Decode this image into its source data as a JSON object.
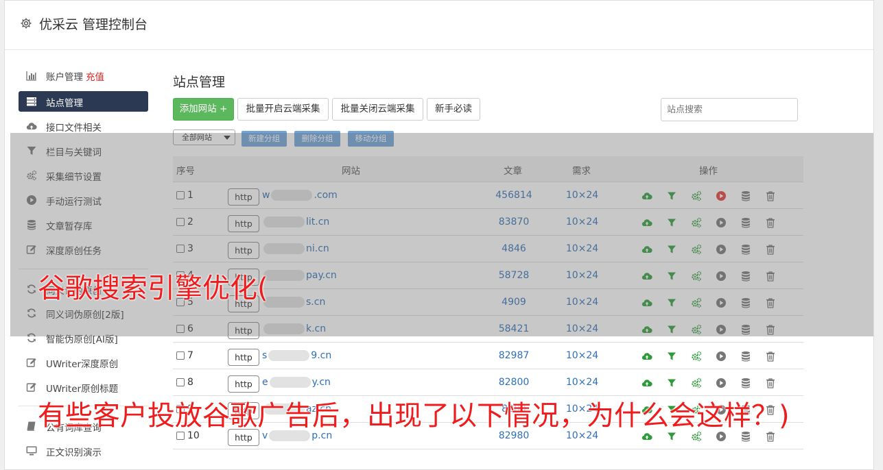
{
  "header": {
    "title": "优采云 管理控制台"
  },
  "sidebar": {
    "items": [
      {
        "label": "账户管理",
        "extra": "充值",
        "icon": "bar-chart-icon"
      },
      {
        "label": "站点管理",
        "icon": "server-icon"
      },
      {
        "label": "接口文件相关",
        "icon": "cloud-upload-icon"
      },
      {
        "label": "栏目与关键词",
        "icon": "filter-icon"
      },
      {
        "label": "采集细节设置",
        "icon": "gears-icon"
      },
      {
        "label": "手动运行测试",
        "icon": "play-circle-icon"
      },
      {
        "label": "文章暂存库",
        "icon": "database-icon"
      },
      {
        "label": "深度原创任务",
        "icon": "edit-icon"
      },
      {
        "label": "同义词伪原创",
        "icon": "refresh-icon"
      },
      {
        "label": "同义词伪原创[2版]",
        "icon": "refresh-icon"
      },
      {
        "label": "智能伪原创[AI版]",
        "icon": "refresh-icon"
      },
      {
        "label": "UWriter深度原创",
        "icon": "edit-icon"
      },
      {
        "label": "UWriter原创标题",
        "icon": "edit-icon"
      },
      {
        "label": "公有词库查询",
        "icon": "book-icon"
      },
      {
        "label": "正文识别演示",
        "icon": "monitor-icon"
      }
    ]
  },
  "main": {
    "title": "站点管理",
    "buttons": {
      "add_site": "添加网站 +",
      "batch_open": "批量开启云端采集",
      "batch_close": "批量关闭云端采集",
      "guide": "新手必读"
    },
    "search_placeholder": "站点搜索",
    "group_select": "全部网站",
    "group_buttons": {
      "new": "新建分组",
      "delete": "删除分组",
      "move": "移动分组"
    },
    "table": {
      "headers": {
        "index": "序号",
        "site": "网站",
        "articles": "文章",
        "demand": "需求",
        "ops": "操作"
      },
      "rows": [
        {
          "num": "1",
          "prefix": "w",
          "suffix": ".com",
          "articles": "456814",
          "demand": "10×24",
          "active": true
        },
        {
          "num": "2",
          "prefix": "",
          "suffix": "lit.cn",
          "articles": "83870",
          "demand": "10×24",
          "active": false
        },
        {
          "num": "3",
          "prefix": "",
          "suffix": "ni.cn",
          "articles": "4846",
          "demand": "10×24",
          "active": false
        },
        {
          "num": "4",
          "prefix": "",
          "suffix": "pay.cn",
          "articles": "58728",
          "demand": "10×24",
          "active": false
        },
        {
          "num": "5",
          "prefix": "",
          "suffix": "s.cn",
          "articles": "4909",
          "demand": "10×24",
          "active": false
        },
        {
          "num": "6",
          "prefix": "",
          "suffix": "k.cn",
          "articles": "58421",
          "demand": "10×24",
          "active": false
        },
        {
          "num": "7",
          "prefix": "s",
          "suffix": "9.cn",
          "articles": "82987",
          "demand": "10×24",
          "active": false
        },
        {
          "num": "8",
          "prefix": "e",
          "suffix": "y.cn",
          "articles": "82800",
          "demand": "10×24",
          "active": false
        },
        {
          "num": "9",
          "prefix": "",
          "suffix": "az.cn",
          "articles": "8283",
          "demand": "10×24",
          "active": false
        },
        {
          "num": "10",
          "prefix": "v",
          "suffix": "p.cn",
          "articles": "82980",
          "demand": "10×24",
          "active": false
        }
      ],
      "http_label": "http"
    }
  },
  "overlay_text": {
    "line1": "谷歌搜索引擎优化(",
    "line2": "有些客户投放谷歌广告后，出现了以下情况，为什么会这样？)"
  },
  "colors": {
    "accent_green": "#5cb85c",
    "sidebar_active": "#2b3a52",
    "link_blue": "#2e6fb5",
    "overlay_red": "#ee1c1c",
    "icon_green": "#2e9b3a",
    "play_red": "#e53935"
  }
}
